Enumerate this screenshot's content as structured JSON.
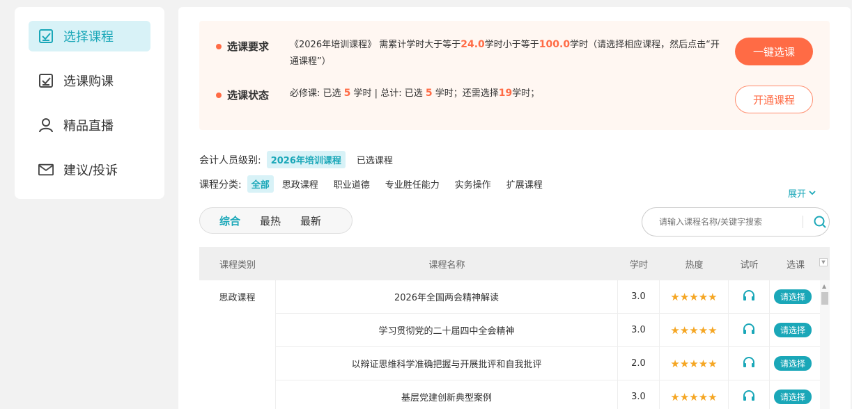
{
  "sidebar": {
    "items": [
      {
        "label": "选择课程",
        "icon": "checkbox-icon",
        "active": true
      },
      {
        "label": "选课购课",
        "icon": "checkbox-icon",
        "active": false
      },
      {
        "label": "精品直播",
        "icon": "user-icon",
        "active": false
      },
      {
        "label": "建议/投诉",
        "icon": "mail-icon",
        "active": false
      }
    ]
  },
  "requirements": {
    "req_title": "选课要求",
    "req_prefix": "《2026年培训课程》 需累计学时大于等于",
    "req_min": "24.0",
    "req_mid": "学时小于等于",
    "req_max": "100.0",
    "req_suffix": "学时（请选择相应课程，然后点击“开通课程”）",
    "status_title": "选课状态",
    "status_a": "必修课:  已选",
    "status_required_selected": "5",
    "status_b": "学时 | 总计:  已选",
    "status_total_selected": "5",
    "status_c": "学时；还需选择",
    "status_remaining": "19",
    "status_d": "学时；",
    "one_click_label": "一键选课",
    "open_label": "开通课程"
  },
  "filters": {
    "level_label": "会计人员级别:",
    "level_options": [
      "2026年培训课程",
      "已选课程"
    ],
    "category_label": "课程分类:",
    "category_options": [
      "全部",
      "思政课程",
      "职业道德",
      "专业胜任能力",
      "实务操作",
      "扩展课程"
    ],
    "expand_label": "展开"
  },
  "sort": {
    "tabs": [
      "综合",
      "最热",
      "最新"
    ]
  },
  "search": {
    "placeholder": "请输入课程名称/关键字搜索"
  },
  "table": {
    "headers": [
      "课程类别",
      "课程名称",
      "学时",
      "热度",
      "试听",
      "选课"
    ],
    "category": "思政课程",
    "rows": [
      {
        "name": "2026年全国两会精神解读",
        "hours": "3.0",
        "stars": "★★★★★",
        "pick": "请选择"
      },
      {
        "name": "学习贯彻党的二十届四中全会精神",
        "hours": "3.0",
        "stars": "★★★★★",
        "pick": "请选择"
      },
      {
        "name": "以辩证思维科学准确把握与开展批评和自我批评",
        "hours": "2.0",
        "stars": "★★★★★",
        "pick": "请选择"
      },
      {
        "name": "基层党建创新典型案例",
        "hours": "3.0",
        "stars": "★★★★★",
        "pick": "请选择"
      }
    ]
  },
  "colors": {
    "accent": "#1aa7b8",
    "highlight": "#ff6b45",
    "star": "#f5a623"
  }
}
